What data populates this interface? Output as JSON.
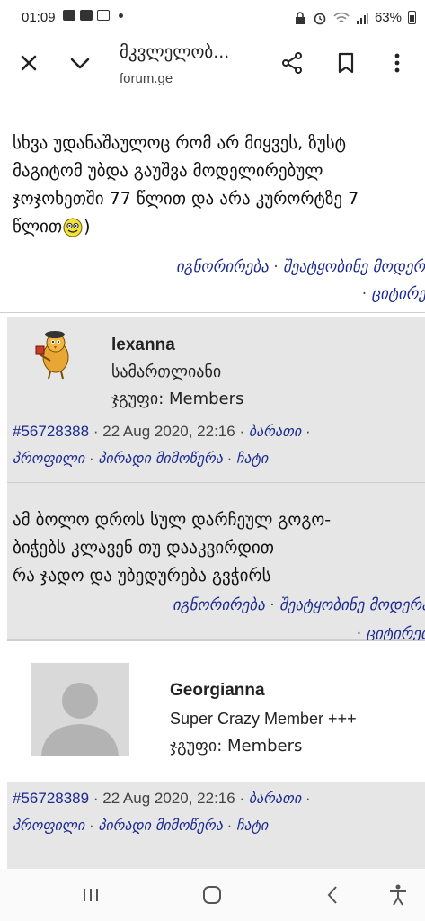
{
  "status_bar": {
    "time": "01:09",
    "battery": "63%"
  },
  "toolbar": {
    "title": "მკვლელობ...",
    "url": "forum.ge"
  },
  "posts": [
    {
      "text_lines": [
        "სხვა უდანაშაულოც რომ არ მიყვეს, ზუსტ",
        "მაგიტომ უბდა გაუშვა მოდელირებულ",
        "ჯოჯოხეთში 77 წლით და არა კურორტზე 7",
        "წლით",
        ")"
      ],
      "links": {
        "ignore": "იგნორირება",
        "report": "შეატყობინე მოდერატ",
        "quote": "ციტირებ"
      }
    }
  ],
  "author1": {
    "name": "lexanna",
    "title": "სამართლიანი",
    "group": "ჯგუფი: Members"
  },
  "meta1": {
    "post_id": "#56728388",
    "date": "22 Aug 2020, 22:16",
    "card": "ბარათი",
    "profile": "პროფილი",
    "pm": "პირადი მიმოწერა",
    "chat": "ჩატი"
  },
  "post2": {
    "text_lines": [
      "ამ ბოლო დროს სულ დარჩეულ გოგო-",
      "ბიჭებს კლავენ თუ დააკვირდით",
      "რა ჯადო და უბედურება გვჭირს"
    ],
    "links": {
      "ignore": "იგნორირება",
      "report": "შეატყობინე მოდერატ",
      "quote": "ციტირებ"
    }
  },
  "author2": {
    "name": "Georgianna",
    "title": "Super Crazy Member +++",
    "group": "ჯგუფი: Members"
  },
  "meta2": {
    "post_id": "#56728389",
    "date": "22 Aug 2020, 22:16",
    "card": "ბარათი",
    "profile": "პროფილი",
    "pm": "პირადი მიმოწერა",
    "chat": "ჩატი"
  },
  "separators": {
    "dot": "·"
  },
  "icons": {
    "close": "close-icon",
    "chevron": "chevron-down-icon",
    "share": "share-icon",
    "bookmark": "bookmark-icon",
    "more": "more-vert-icon",
    "recents": "recents-icon",
    "home": "home-icon",
    "back": "back-icon",
    "accessibility": "accessibility-icon"
  },
  "colors": {
    "link": "#1b2a8f",
    "post_bg": "#e6e6e6"
  }
}
